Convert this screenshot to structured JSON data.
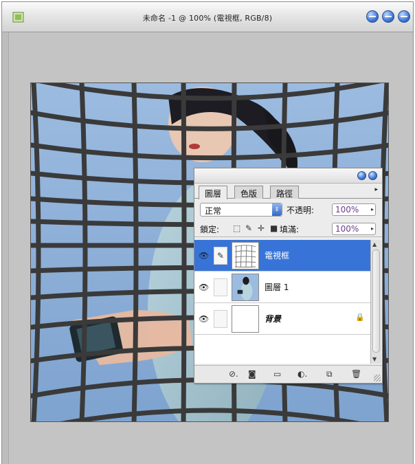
{
  "window": {
    "title": "未命名 -1 @ 100% (電視框, RGB/8)"
  },
  "layers_panel": {
    "tabs": [
      "圖層",
      "色版",
      "路徑"
    ],
    "active_tab": 0,
    "blend_mode": "正常",
    "opacity_label": "不透明:",
    "opacity_value": "100%",
    "lock_label": "鎖定:",
    "fill_label": "填滿:",
    "fill_value": "100%",
    "layers": [
      {
        "name": "電視框",
        "selected": true,
        "visible": true
      },
      {
        "name": "圖層 1",
        "selected": false,
        "visible": true
      },
      {
        "name": "背景",
        "selected": false,
        "visible": true,
        "locked": true
      }
    ]
  },
  "colors": {
    "selection": "#3874d8",
    "sky": "#8fb0d8",
    "frame": "#3a3a3a"
  },
  "icons": {
    "eye": "eye-icon",
    "brush": "brush-icon",
    "lock": "lock-icon",
    "link": "link-layers-icon",
    "style": "layer-style-icon",
    "mask": "layer-mask-icon",
    "folder": "new-group-icon",
    "adjust": "adjustment-layer-icon",
    "new": "new-layer-icon",
    "trash": "trash-icon"
  }
}
